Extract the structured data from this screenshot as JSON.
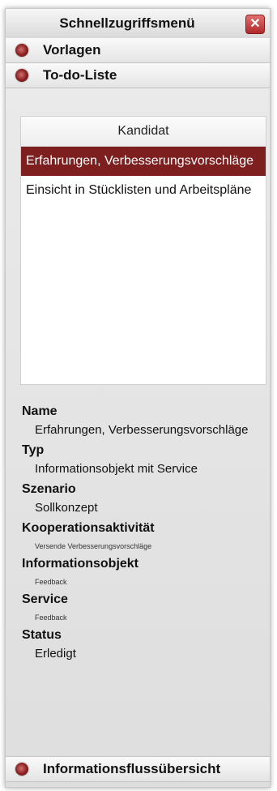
{
  "window": {
    "title": "Schnellzugriffsmenü",
    "close_icon": "close-icon"
  },
  "accordion": {
    "vorlagen": "Vorlagen",
    "todo": "To-do-Liste",
    "infofluss": "Informationsflussübersicht"
  },
  "list": {
    "header": "Kandidat",
    "items": [
      "Erfahrungen, Verbesserungsvorschläge",
      "Einsicht in Stücklisten und Arbeitspläne"
    ],
    "selected_index": 0
  },
  "details": {
    "name_label": "Name",
    "name_value": "Erfahrungen, Verbesserungsvorschläge",
    "typ_label": "Typ",
    "typ_value": "Informationsobjekt mit Service",
    "szenario_label": "Szenario",
    "szenario_value": "Sollkonzept",
    "koop_label": "Kooperationsaktivität",
    "koop_value": "Versende Verbesserungsvorschläge",
    "infoobj_label": "Informationsobjekt",
    "infoobj_value": "Feedback",
    "service_label": "Service",
    "service_value": "Feedback",
    "status_label": "Status",
    "status_value": "Erledigt"
  },
  "colors": {
    "accent": "#7e1f1f",
    "close": "#b02a2a"
  }
}
